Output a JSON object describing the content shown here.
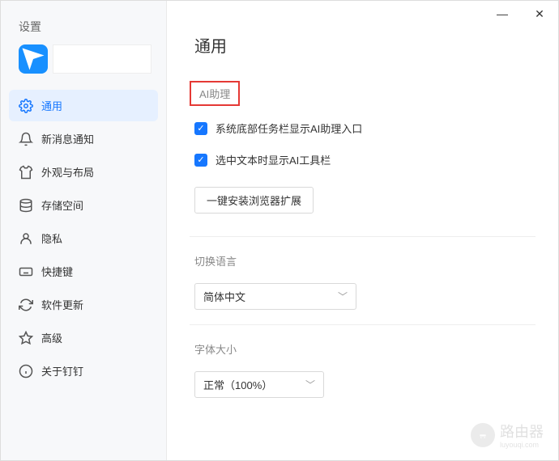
{
  "window": {
    "sidebar_title": "设置"
  },
  "nav": {
    "items": [
      {
        "label": "通用"
      },
      {
        "label": "新消息通知"
      },
      {
        "label": "外观与布局"
      },
      {
        "label": "存储空间"
      },
      {
        "label": "隐私"
      },
      {
        "label": "快捷键"
      },
      {
        "label": "软件更新"
      },
      {
        "label": "高级"
      },
      {
        "label": "关于钉钉"
      }
    ]
  },
  "page": {
    "title": "通用",
    "sections": {
      "ai": {
        "label": "AI助理",
        "check1": "系统底部任务栏显示AI助理入口",
        "check2": "选中文本时显示AI工具栏",
        "install_btn": "一键安装浏览器扩展"
      },
      "lang": {
        "label": "切换语言",
        "value": "简体中文"
      },
      "font": {
        "label": "字体大小",
        "value": "正常（100%）"
      }
    }
  },
  "watermark": {
    "text": "路由器",
    "sub": "luyouqi.com"
  }
}
